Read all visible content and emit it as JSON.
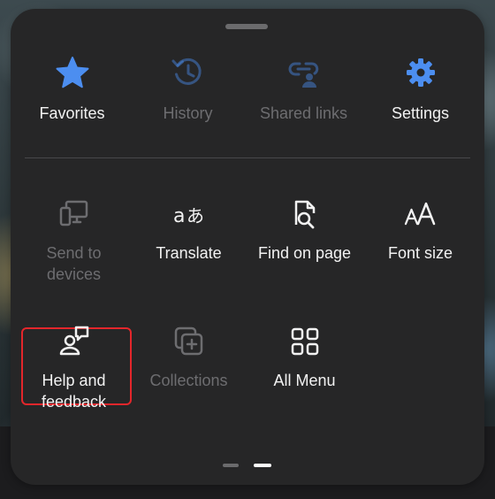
{
  "colors": {
    "panel_bg": "#262627",
    "accent_blue": "#4c8ef0",
    "disabled_text": "#6d6d70",
    "enabled_text": "#f2f2f2",
    "highlight_border": "#e3262b"
  },
  "top_row": [
    {
      "label": "Favorites",
      "icon": "star-icon",
      "enabled": true
    },
    {
      "label": "History",
      "icon": "history-icon",
      "enabled": false
    },
    {
      "label": "Shared links",
      "icon": "shared-links-icon",
      "enabled": false
    },
    {
      "label": "Settings",
      "icon": "gear-icon",
      "enabled": true
    }
  ],
  "middle_row": [
    {
      "label_line1": "Send to",
      "label_line2": "devices",
      "icon": "send-to-devices-icon",
      "enabled": false
    },
    {
      "label": "Translate",
      "icon": "translate-icon",
      "enabled": true
    },
    {
      "label": "Find on page",
      "icon": "find-on-page-icon",
      "enabled": true
    },
    {
      "label": "Font size",
      "icon": "font-size-icon",
      "enabled": true
    }
  ],
  "bottom_row": [
    {
      "label_line1": "Help and",
      "label_line2": "feedback",
      "icon": "help-feedback-icon",
      "enabled": true,
      "highlighted": true
    },
    {
      "label": "Collections",
      "icon": "collections-icon",
      "enabled": false
    },
    {
      "label": "All Menu",
      "icon": "all-menu-icon",
      "enabled": true
    }
  ],
  "pager": {
    "pages": 2,
    "current": 2
  }
}
